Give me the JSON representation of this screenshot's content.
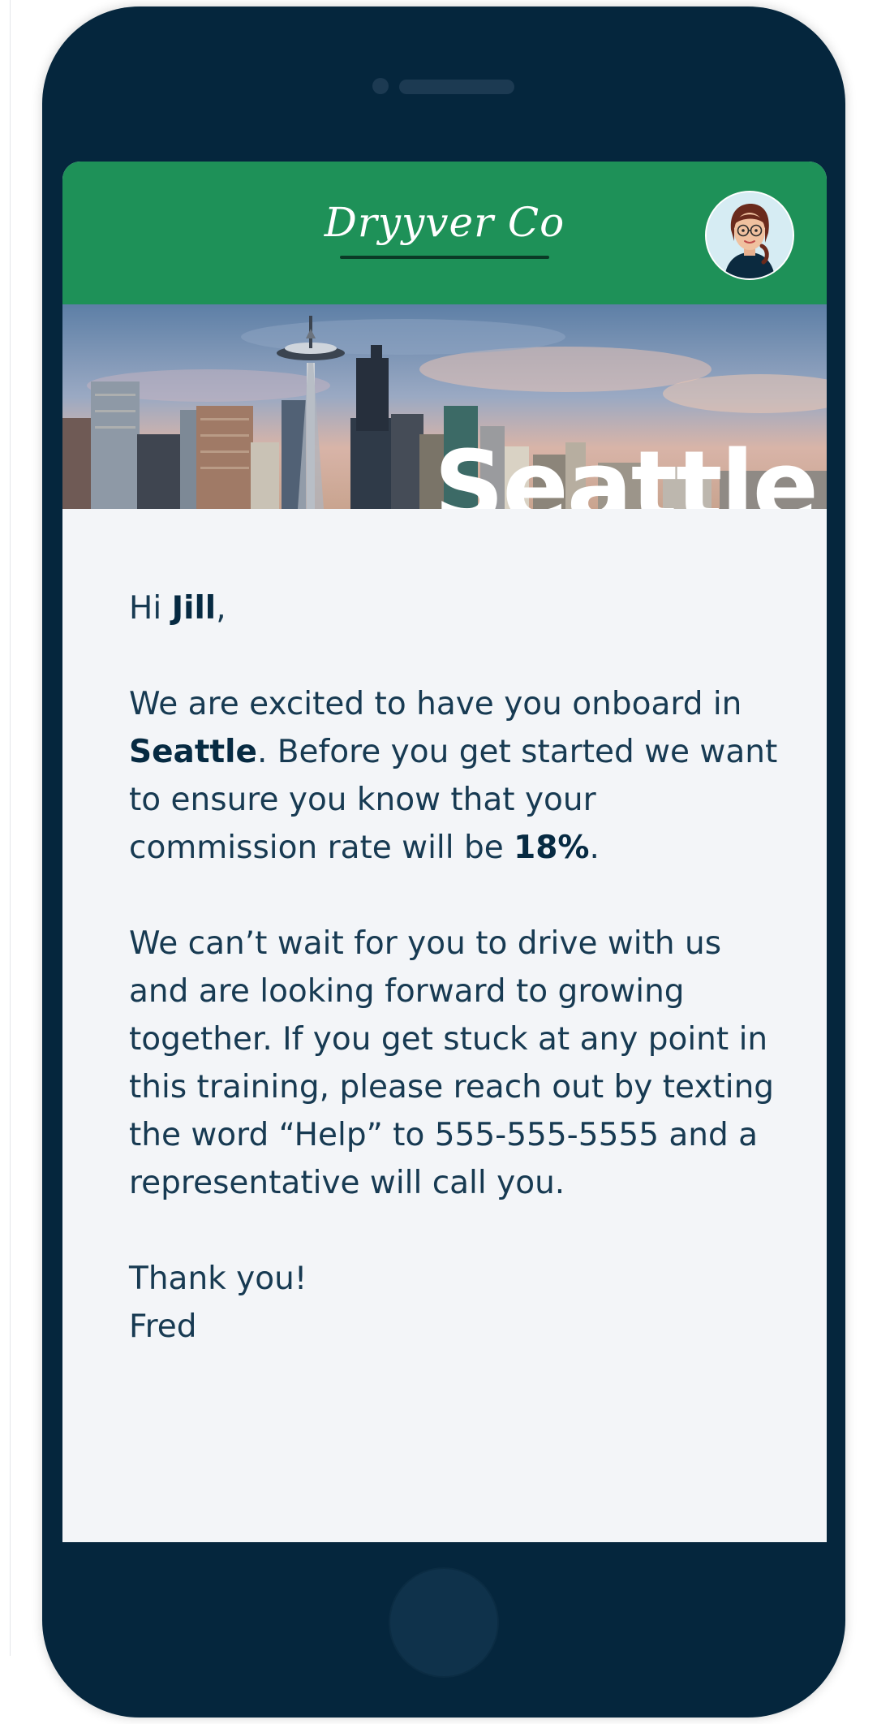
{
  "header": {
    "brand": "Dryyver Co"
  },
  "banner": {
    "city_word": "Seattle"
  },
  "message": {
    "greeting_prefix": "Hi ",
    "recipient": "Jill",
    "greeting_suffix": ",",
    "p1_a": "We are excited to have you onboard in ",
    "city": "Seattle",
    "p1_b": ". Before you get started we want to ensure you know that your commission rate will be ",
    "rate": "18%",
    "p1_c": ".",
    "p2": "We can’t wait for you to drive with us and are looking forward to growing together. If you get stuck at any point in this training, please reach out by texting the word “Help” to 555-555-5555 and a representative will call you.",
    "closing": "Thank you!",
    "sender": "Fred"
  },
  "colors": {
    "header_green": "#1e9158",
    "phone_frame": "#05263d",
    "screen_bg": "#f3f5f8",
    "text": "#173a52"
  },
  "icons": {
    "avatar": "woman-avatar-icon",
    "banner": "seattle-skyline-image"
  }
}
